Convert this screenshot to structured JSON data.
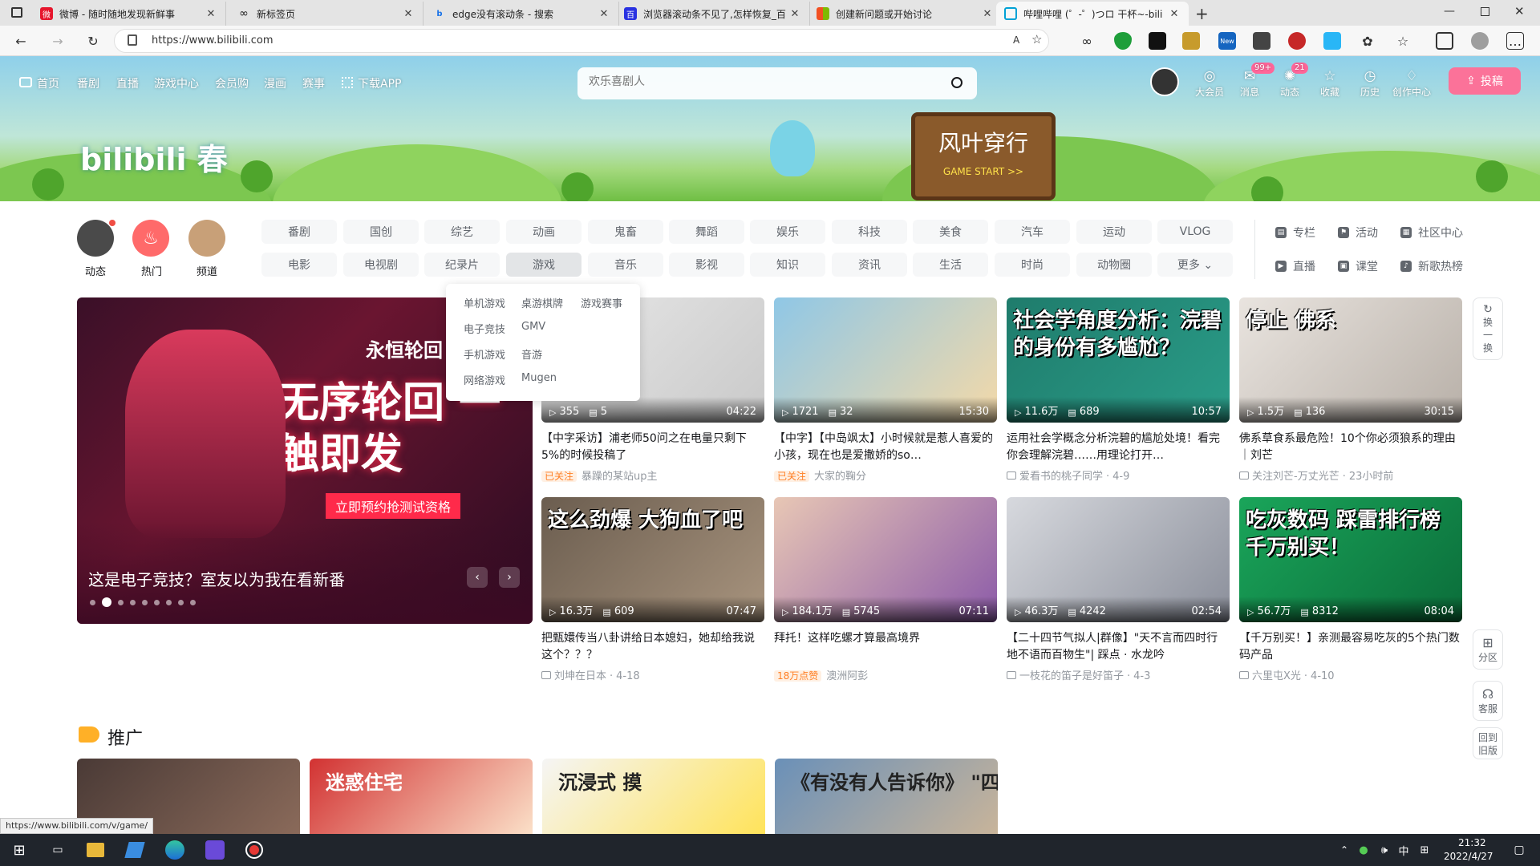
{
  "browser": {
    "tabs": [
      {
        "title": "微博 - 随时随地发现新鲜事",
        "favicon": "weibo-icon",
        "color": "#e6162d"
      },
      {
        "title": "新标签页",
        "favicon": "infinity-icon",
        "color": "#222222"
      },
      {
        "title": "edge没有滚动条 - 搜索",
        "favicon": "bing-icon",
        "color": "#1a73e8"
      },
      {
        "title": "浏览器滚动条不见了,怎样恢复_百",
        "favicon": "baidu-icon",
        "color": "#2932e1"
      },
      {
        "title": "创建新问题或开始讨论",
        "favicon": "ms-icon",
        "color": "#f25022"
      },
      {
        "title": "哔哩哔哩 (゜-゜)つロ 干杯~-bili",
        "favicon": "bilibili-icon",
        "color": "#00a1d6"
      }
    ],
    "url": "https://www.bilibili.com",
    "status_url": "https://www.bilibili.com/v/game/"
  },
  "nav": {
    "left": [
      "首页",
      "番剧",
      "直播",
      "游戏中心",
      "会员购",
      "漫画",
      "赛事",
      "下载APP"
    ],
    "search_placeholder": "欢乐喜剧人",
    "right": [
      {
        "label": "大会员",
        "icon": "vip-icon"
      },
      {
        "label": "消息",
        "icon": "message-icon",
        "badge": "99+"
      },
      {
        "label": "动态",
        "icon": "dynamic-icon",
        "badge": "21"
      },
      {
        "label": "收藏",
        "icon": "star-icon"
      },
      {
        "label": "历史",
        "icon": "history-icon"
      },
      {
        "label": "创作中心",
        "icon": "bulb-icon"
      }
    ],
    "upload": "投稿"
  },
  "banner": {
    "logo_text": "bilibili 春",
    "sign_text": "风叶穿行",
    "sign_sub": "GAME START >>"
  },
  "channels": {
    "circles": [
      "动态",
      "热门",
      "频道"
    ],
    "row1": [
      "番剧",
      "国创",
      "综艺",
      "动画",
      "鬼畜",
      "舞蹈",
      "娱乐",
      "科技",
      "美食",
      "汽车",
      "运动",
      "VLOG"
    ],
    "row2": [
      "电影",
      "电视剧",
      "纪录片",
      "游戏",
      "音乐",
      "影视",
      "知识",
      "资讯",
      "生活",
      "时尚",
      "动物圈",
      "更多"
    ],
    "side": [
      "专栏",
      "活动",
      "社区中心",
      "直播",
      "课堂",
      "新歌热榜"
    ]
  },
  "dropdown": [
    [
      "单机游戏",
      "桌游棋牌",
      "游戏赛事"
    ],
    [
      "电子竞技",
      "GMV",
      ""
    ],
    [
      "手机游戏",
      "音游",
      ""
    ],
    [
      "网络游戏",
      "Mugen",
      ""
    ]
  ],
  "carousel": {
    "title": "这是电子竞技？室友以为我在看新番",
    "game_logo": "永恒轮回",
    "headline": "无序轮回 一触即发",
    "sub": "立即预约抢测试资格"
  },
  "videos": [
    {
      "views": "355",
      "danmaku": "5",
      "duration": "04:22",
      "title": "【中字采访】浦老师50问之在电量只剩下5%的时候投稿了",
      "tag": "已关注",
      "author": "暴躁的某站up主",
      "date": ""
    },
    {
      "views": "1721",
      "danmaku": "32",
      "duration": "15:30",
      "title": "【中字】【中岛飒太】小时候就是惹人喜爱的小孩，现在也是爱撒娇的so…",
      "tag": "已关注",
      "author": "大家的鞠分",
      "date": ""
    },
    {
      "views": "11.6万",
      "danmaku": "689",
      "duration": "10:57",
      "title": "运用社会学概念分析浣碧的尴尬处境！看完你会理解浣碧……用理论打开…",
      "tag": "",
      "author": "爱看书的桃子同学",
      "date": "4-9"
    },
    {
      "views": "1.5万",
      "danmaku": "136",
      "duration": "30:15",
      "title": "佛系草食系最危险！10个你必须狼系的理由｜刘芒",
      "tag": "",
      "author": "关注刘芒-万丈光芒",
      "date": "23小时前"
    },
    {
      "views": "16.3万",
      "danmaku": "609",
      "duration": "07:47",
      "title": "把甄嬛传当八卦讲给日本媳妇，她却给我说这个？？？",
      "tag": "",
      "author": "刘坤在日本",
      "date": "4-18"
    },
    {
      "views": "184.1万",
      "danmaku": "5745",
      "duration": "07:11",
      "title": "拜托！这样吃螺才算最高境界",
      "tag": "18万点赞",
      "author": "澳洲阿彭",
      "date": ""
    },
    {
      "views": "46.3万",
      "danmaku": "4242",
      "duration": "02:54",
      "title": "【二十四节气拟人|群像】\"天不言而四时行 地不语而百物生\"| 踩点 · 水龙吟",
      "tag": "",
      "author": "一枝花的笛子是好笛子",
      "date": "4-3"
    },
    {
      "views": "56.7万",
      "danmaku": "8312",
      "duration": "08:04",
      "title": "【千万别买！】亲测最容易吃灰的5个热门数码产品",
      "tag": "",
      "author": "六里屯X光",
      "date": "4-10"
    }
  ],
  "thumb_texts": [
    "",
    "",
    "社会学角度分析：浣碧的身份有多尴尬？",
    "停止 佛系",
    "这么劲爆 大狗血了吧",
    "",
    "",
    "吃灰数码 踩雷排行榜 千万别买！"
  ],
  "right_tools": [
    "换一换",
    "分区",
    "客服",
    "回到旧版"
  ],
  "promo": {
    "title": "推广",
    "thumbs": [
      "",
      "迷惑住宅",
      "沉浸式 摸",
      "《有没有人告诉你》 \"四胞胎\"乐队"
    ]
  },
  "taskbar": {
    "time": "21:32",
    "date": "2022/4/27",
    "ime": "中"
  }
}
